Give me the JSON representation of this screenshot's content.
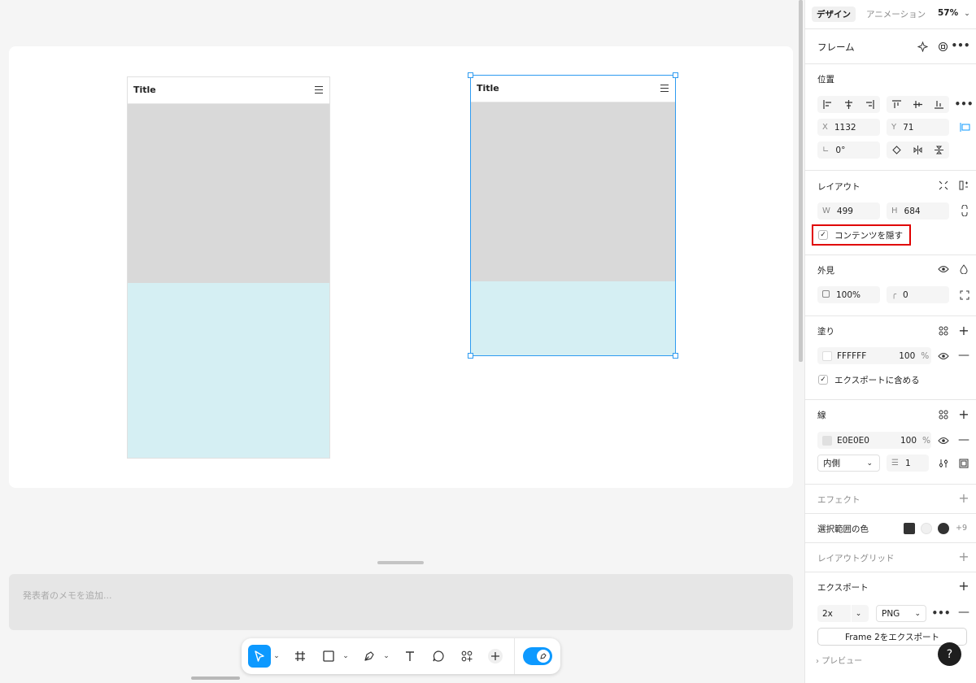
{
  "canvas": {
    "frames": [
      {
        "title": "Title"
      },
      {
        "title": "Title"
      }
    ],
    "notes_placeholder": "発表者のメモを追加..."
  },
  "toolbar": {
    "tools": [
      "move-tool",
      "frame-tool",
      "shape-tool",
      "pen-tool",
      "text-tool",
      "comment-tool",
      "components-tool",
      "add-tool",
      "dev-mode-toggle"
    ]
  },
  "panel": {
    "tabs": {
      "design": "デザイン",
      "animation": "アニメーション"
    },
    "zoom": "57%",
    "frame_label": "フレーム",
    "position": {
      "title": "位置",
      "x_label": "X",
      "x": "1132",
      "y_label": "Y",
      "y": "71",
      "rotation": "0°"
    },
    "layout": {
      "title": "レイアウト",
      "w_label": "W",
      "w": "499",
      "h_label": "H",
      "h": "684",
      "clip_content": "コンテンツを隠す"
    },
    "appearance": {
      "title": "外見",
      "opacity": "100%",
      "radius": "0"
    },
    "fill": {
      "title": "塗り",
      "hex": "FFFFFF",
      "opacity": "100",
      "unit": "%",
      "swatch": "#FFFFFF",
      "include_export": "エクスポートに含める"
    },
    "stroke": {
      "title": "線",
      "hex": "E0E0E0",
      "opacity": "100",
      "unit": "%",
      "swatch": "#E0E0E0",
      "position": "内側",
      "weight": "1"
    },
    "effects": {
      "title": "エフェクト"
    },
    "selection_colors": {
      "title": "選択範囲の色",
      "colors": [
        "#333333",
        "#F0F0F0",
        "#333333"
      ],
      "more": "+9"
    },
    "layout_grid": {
      "title": "レイアウトグリッド"
    },
    "export": {
      "title": "エクスポート",
      "scale": "2x",
      "format": "PNG",
      "button": "Frame 2をエクスポート",
      "preview": "プレビュー"
    },
    "help": "?",
    "highlight_color": "#e00000"
  }
}
